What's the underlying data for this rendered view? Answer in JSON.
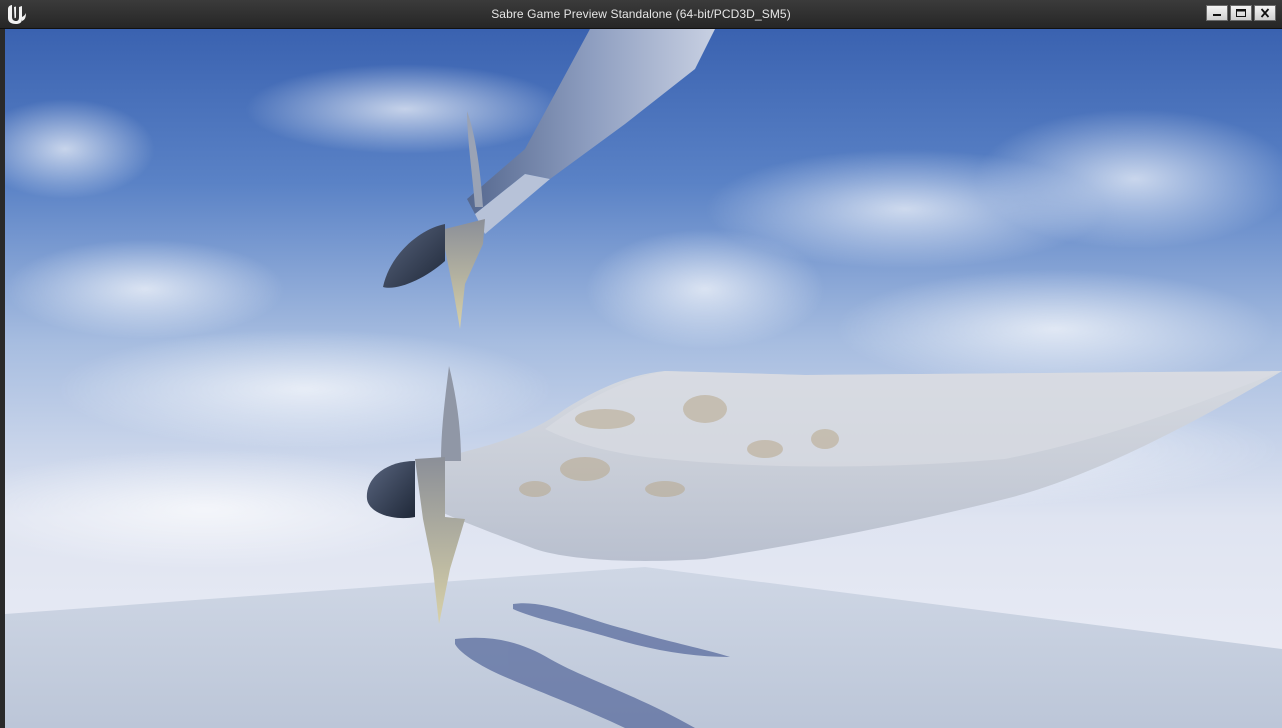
{
  "window": {
    "title": "Sabre Game Preview Standalone (64-bit/PCD3D_SM5)",
    "logo_icon": "unreal-engine-logo-icon",
    "controls": {
      "minimize_icon": "minimize-icon",
      "maximize_icon": "maximize-icon",
      "close_icon": "close-icon"
    }
  },
  "scene": {
    "objects": [
      "sabre-upper",
      "sabre-lower",
      "ground-plane",
      "sky"
    ],
    "colors": {
      "sky_top": "#3f66b2",
      "sky_horizon": "#e4e7f2",
      "ground": "#cfd6e3",
      "blade_metal": "#d6dbe4",
      "guard_metal": "#b9b08a"
    }
  }
}
